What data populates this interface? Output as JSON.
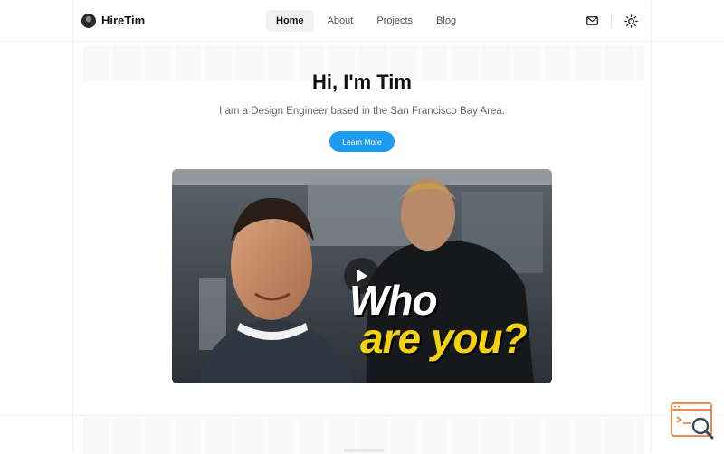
{
  "brand": {
    "name": "HireTim"
  },
  "nav": [
    {
      "label": "Home",
      "active": true
    },
    {
      "label": "About",
      "active": false
    },
    {
      "label": "Projects",
      "active": false
    },
    {
      "label": "Blog",
      "active": false
    }
  ],
  "header_icons": [
    "mail-icon",
    "sun-icon"
  ],
  "hero": {
    "title": "Hi, I'm Tim",
    "subtitle": "I am a Design Engineer based in the San Francisco Bay Area.",
    "cta_label": "Learn More"
  },
  "video": {
    "overlay_line1": "Who",
    "overlay_line2": "are you?",
    "play_icon": "play-icon"
  },
  "colors": {
    "accent": "#1c9cf0",
    "overlay_yellow": "#f4d20f"
  }
}
